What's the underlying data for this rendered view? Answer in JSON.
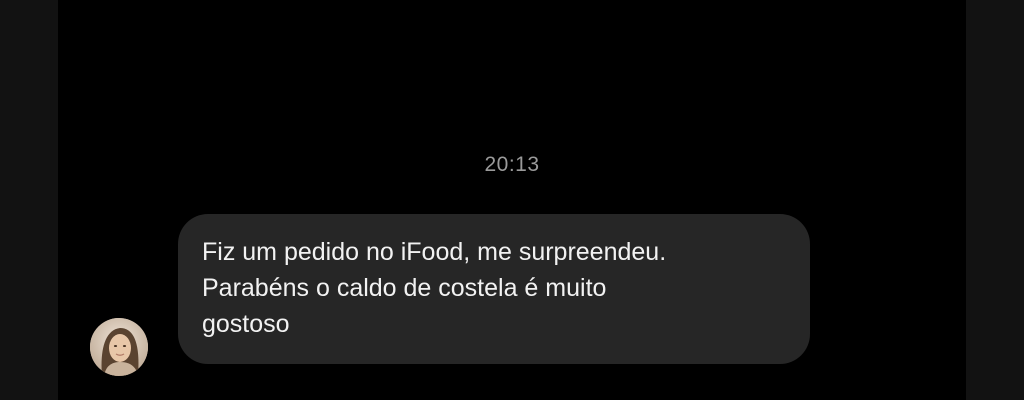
{
  "chat": {
    "timestamp": "20:13",
    "message": {
      "lines": [
        "Fiz um pedido no iFood, me surpreendeu.",
        "Parabéns o caldo de costela é muito",
        "gostoso"
      ]
    }
  },
  "colors": {
    "background": "#000000",
    "bubble": "#262626",
    "text": "#f2f2f2",
    "timestamp": "#9a9a9a"
  },
  "icons": {
    "avatar": "user-avatar-photo"
  }
}
